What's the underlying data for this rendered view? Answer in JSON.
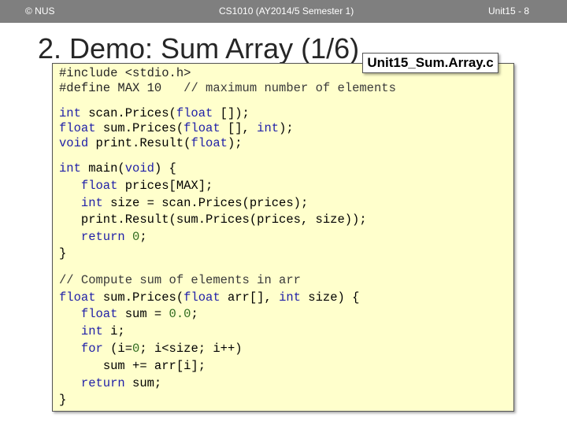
{
  "header": {
    "left": "© NUS",
    "center": "CS1010 (AY2014/5 Semester 1)",
    "right": "Unit15 - 8"
  },
  "slide": {
    "title": "2. Demo: Sum Array (1/6)",
    "filename": "Unit15_Sum.Array.c"
  },
  "code": {
    "include": "#include <stdio.h>",
    "define": "#define MAX 10",
    "define_comment": "// maximum number of elements",
    "proto1_kw": "int",
    "proto1_rest": " scan.Prices(",
    "proto1_kw2": "float",
    "proto1_end": " []);",
    "proto2_kw": "float",
    "proto2_rest": " sum.Prices(",
    "proto2_kw2": "float",
    "proto2_mid": " [], ",
    "proto2_kw3": "int",
    "proto2_end": ");",
    "proto3_kw": "void",
    "proto3_rest": " print.Result(",
    "proto3_kw2": "float",
    "proto3_end": ");",
    "main_kw": "int",
    "main_rest": " main(",
    "main_kw2": "void",
    "main_end": ") {",
    "m1_kw": "float",
    "m1_rest": " prices[MAX];",
    "m2_kw": "int",
    "m2_rest": " size = scan.Prices(prices);",
    "m3": "print.Result(sum.Prices(prices, size));",
    "m4_kw": "return",
    "m4_num": "0",
    "m4_end": ";",
    "close": "}",
    "comment2": "// Compute sum of elements in arr",
    "f_kw": "float",
    "f_rest": " sum.Prices(",
    "f_kw2": "float",
    "f_mid": " arr[], ",
    "f_kw3": "int",
    "f_end": " size) {",
    "s1_kw": "float",
    "s1_rest": " sum = ",
    "s1_num": "0.0",
    "s1_end": ";",
    "s2_kw": "int",
    "s2_rest": " i;",
    "s3_kw": "for",
    "s3_a": " (i=",
    "s3_num": "0",
    "s3_b": "; i<size; i++)",
    "s4": "sum += arr[i];",
    "s5_kw": "return",
    "s5_rest": " sum;",
    "close2": "}"
  }
}
